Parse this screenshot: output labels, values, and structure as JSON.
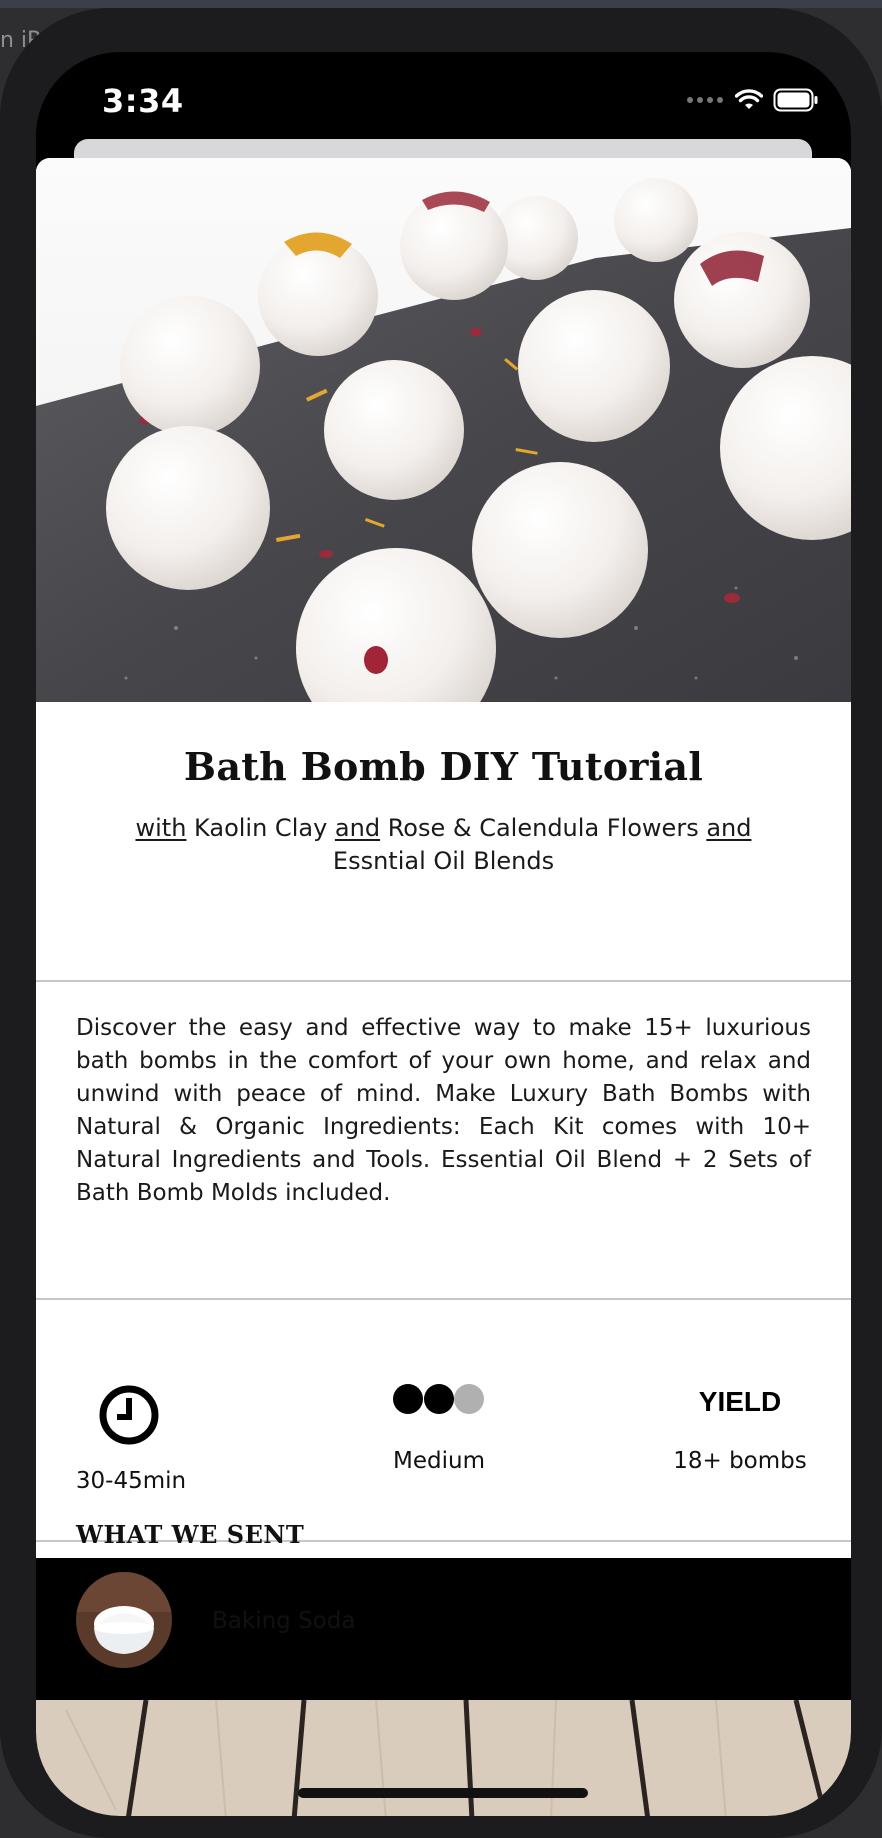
{
  "status_bar": {
    "time": "3:34"
  },
  "simulator": {
    "fragment": "n iP"
  },
  "tutorial": {
    "title": "Bath Bomb DIY Tutorial",
    "subtitle_parts": [
      "with",
      " Kaolin Clay ",
      "and",
      " Rose & Calendula Flowers ",
      "and",
      " Essntial Oil Blends"
    ],
    "description": "Discover the easy and effective way to make 15+ luxurious bath bombs in the comfort of your own home, and relax and unwind with peace of mind. Make Luxury Bath Bombs with Natural & Organic Ingredients: Each Kit comes with 10+ Natural Ingredients and Tools. Essential Oil Blend + 2 Sets of Bath Bomb Molds included."
  },
  "stats": {
    "time_icon": "clock-icon",
    "time_value": "30-45min",
    "difficulty_icon": "difficulty-dots-icon",
    "difficulty_level": 2,
    "difficulty_max": 3,
    "difficulty_label": "Medium",
    "yield_word": "YIELD",
    "yield_value": "18+ bombs"
  },
  "what_we_sent": {
    "heading": "WHAT WE SENT",
    "items": [
      {
        "label": "Baking Soda",
        "icon": "baking-soda-bowl-image"
      }
    ]
  },
  "colors": {
    "accent": "#000000",
    "divider": "#c8c8c8",
    "dot_inactive": "#b0b0b0"
  }
}
